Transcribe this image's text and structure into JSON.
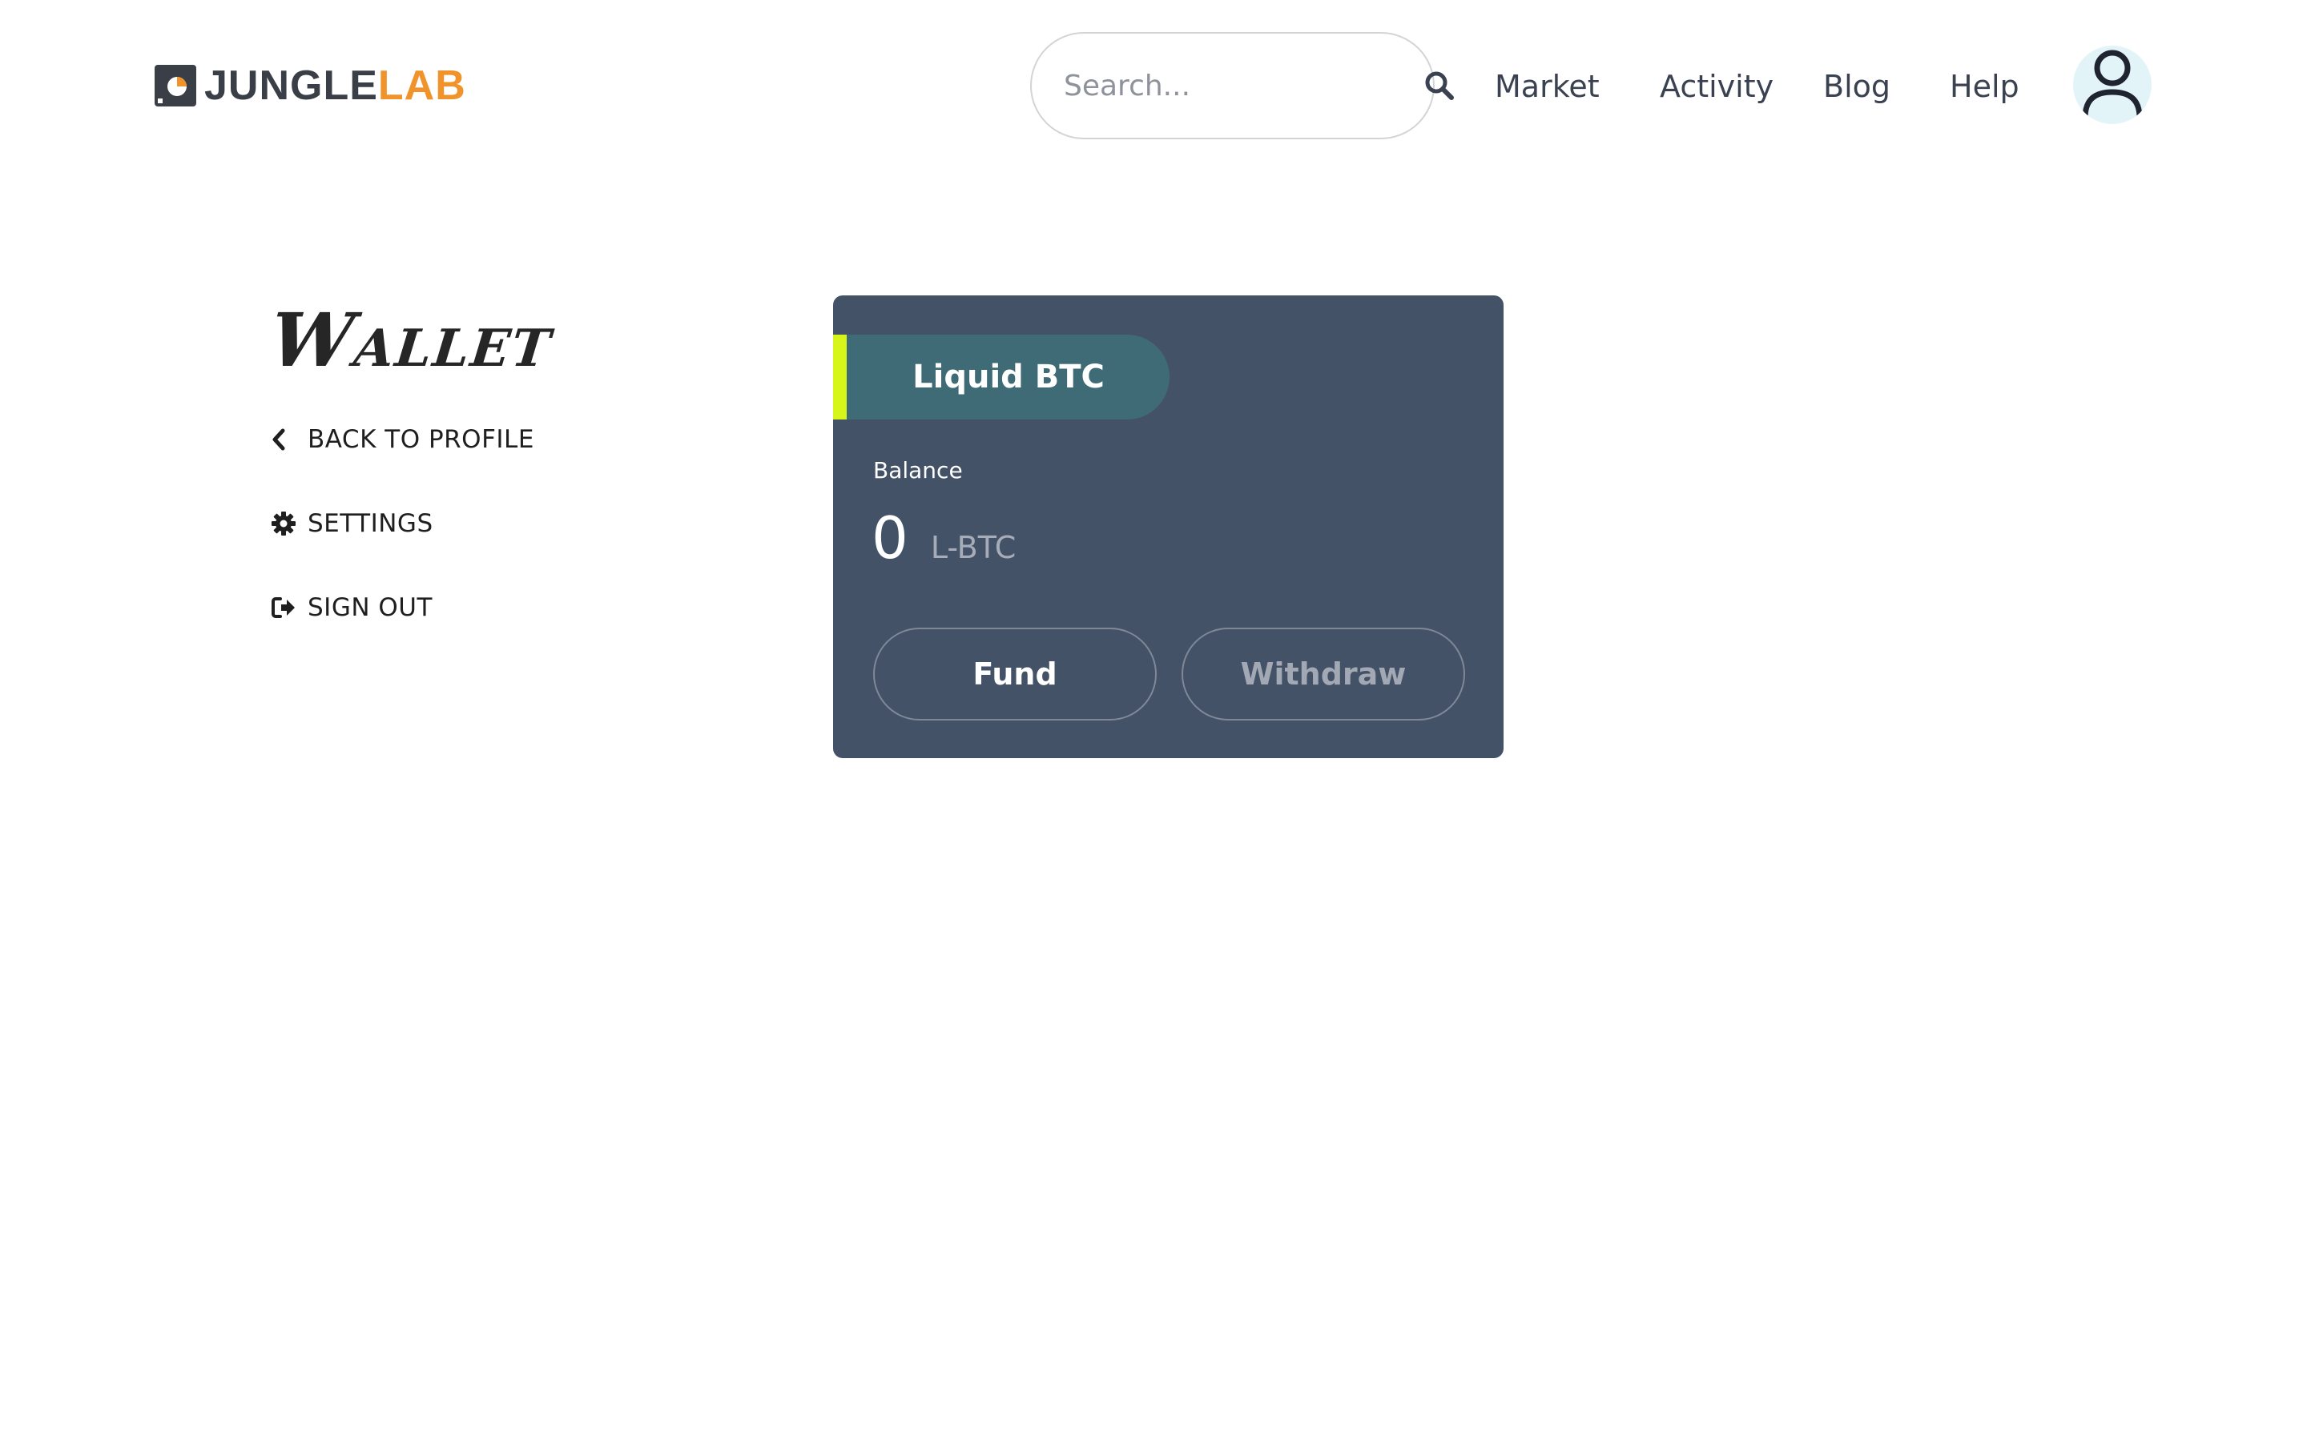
{
  "brand": {
    "name_part1": "JUNGLE",
    "name_part2": "LAB",
    "color_primary": "#3a3f47",
    "color_accent": "#f0932b"
  },
  "search": {
    "placeholder": "Search...",
    "value": "",
    "icon": "search-icon"
  },
  "nav": {
    "items": [
      {
        "label": "Market"
      },
      {
        "label": "Activity"
      },
      {
        "label": "Blog"
      },
      {
        "label": "Help"
      }
    ]
  },
  "user": {
    "avatar_icon": "user-icon"
  },
  "sidebar": {
    "title": "Wallet",
    "links": [
      {
        "label": "BACK TO PROFILE",
        "icon": "chevron-left-icon"
      },
      {
        "label": "SETTINGS",
        "icon": "gear-icon"
      },
      {
        "label": "SIGN OUT",
        "icon": "sign-out-icon"
      }
    ]
  },
  "wallet_card": {
    "asset_name": "Liquid BTC",
    "balance_label": "Balance",
    "balance_value": "0",
    "balance_unit": "L-BTC",
    "fund_label": "Fund",
    "withdraw_label": "Withdraw",
    "card_color": "#445268",
    "tab_color": "#3e6b76",
    "accent_color": "#d6f518"
  }
}
